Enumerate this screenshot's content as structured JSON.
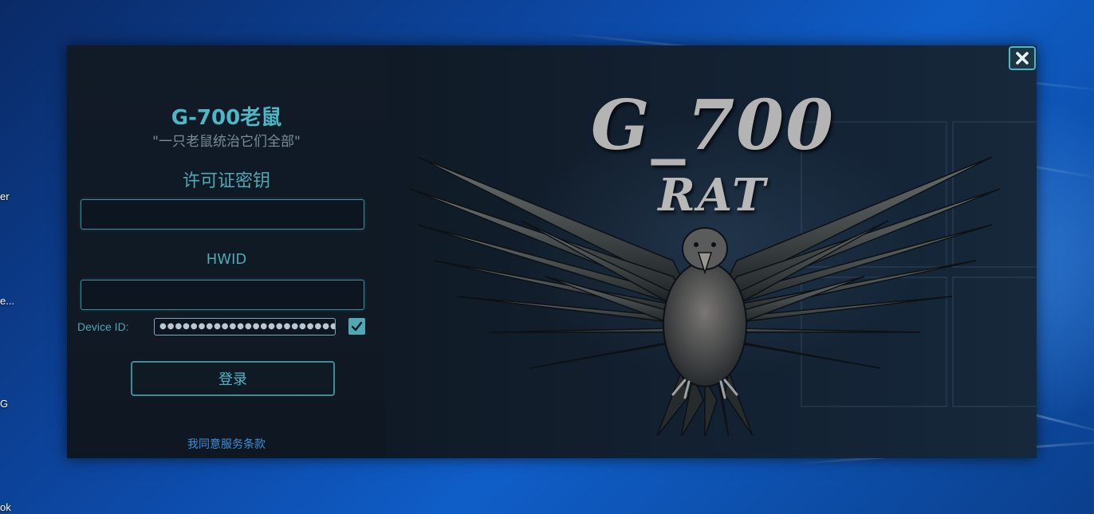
{
  "window": {
    "title": "G-700老鼠",
    "subtitle": "\"一只老鼠统治它们全部\"",
    "close_icon": "close-icon"
  },
  "form": {
    "license_label": "许可证密钥",
    "license_value": "",
    "hwid_label": "HWID",
    "hwid_value": "",
    "device_label": "Device ID:",
    "device_value": "●●●●●●●●●●●●●●●●●●●●●●●●●●",
    "device_checked": true,
    "login_label": "登录",
    "terms_label": "我同意服务条款"
  },
  "art": {
    "title": "G_700",
    "subtitle": "RAT",
    "image_icon": "eagle-icon"
  },
  "desktop": {
    "labels": [
      "er",
      "e...",
      "G",
      "ok"
    ]
  },
  "colors": {
    "accent": "#4fb6c4",
    "link": "#3a8fd8",
    "window_bg": "#0f1722"
  }
}
